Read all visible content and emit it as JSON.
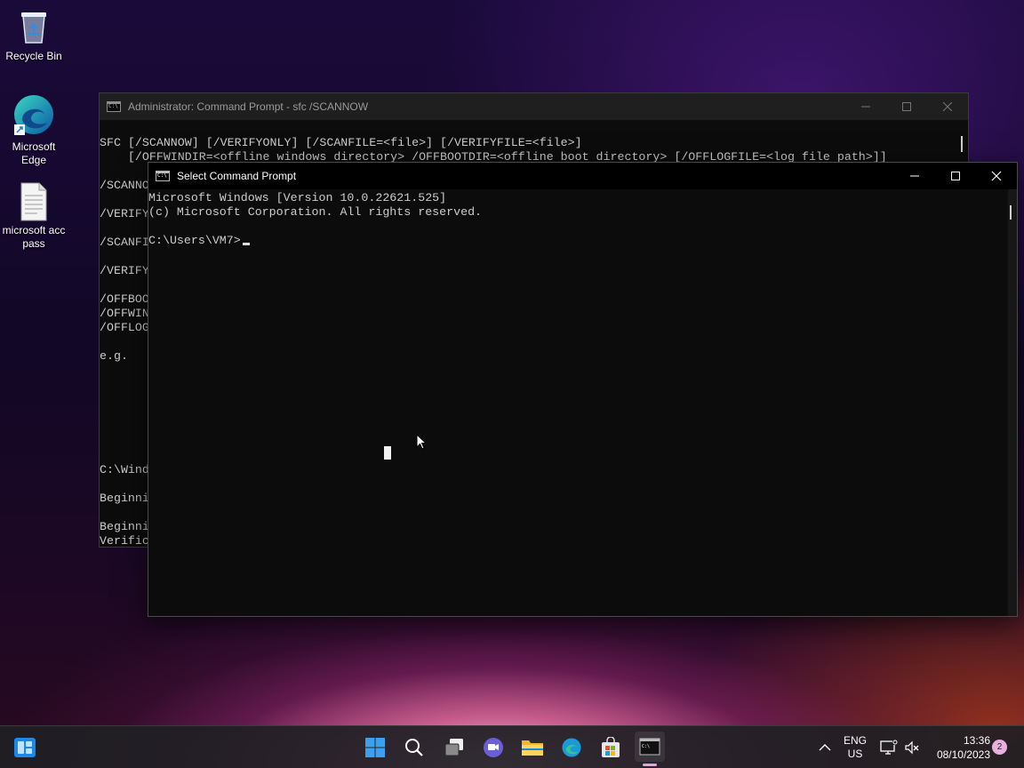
{
  "desktop": {
    "icons": [
      {
        "label": "Recycle Bin"
      },
      {
        "label": "Microsoft Edge"
      },
      {
        "label": "microsoft acc pass"
      }
    ]
  },
  "back_window": {
    "title": "Administrator: Command Prompt - sfc  /SCANNOW",
    "lines": [
      "SFC [/SCANNOW] [/VERIFYONLY] [/SCANFILE=<file>] [/VERIFYFILE=<file>]",
      "    [/OFFWINDIR=<offline windows directory> /OFFBOOTDIR=<offline boot directory> [/OFFLOGFILE=<log file path>]]",
      "",
      "/SCANNO",
      "",
      "/VERIFY",
      "",
      "/SCANFI",
      "",
      "/VERIFY",
      "",
      "/OFFBOO",
      "/OFFWIN",
      "/OFFLOG",
      "",
      "e.g.",
      "",
      "",
      "",
      "",
      "",
      "",
      "",
      "C:\\Wind",
      "",
      "Beginni",
      "",
      "Beginni",
      "Verific"
    ]
  },
  "front_window": {
    "title": "Select Command Prompt",
    "lines": [
      "Microsoft Windows [Version 10.0.22621.525]",
      "(c) Microsoft Corporation. All rights reserved.",
      "",
      "C:\\Users\\VM7>"
    ]
  },
  "tray": {
    "lang_top": "ENG",
    "lang_bottom": "US",
    "time": "13:36",
    "date": "08/10/2023",
    "notification_count": "2"
  },
  "taskbar_icons": [
    "start-icon",
    "search-icon",
    "task-view-icon",
    "chat-icon",
    "file-explorer-icon",
    "edge-icon",
    "store-icon",
    "terminal-icon"
  ],
  "colors": {
    "console_bg": "#0c0c0c",
    "console_fg": "#cccccc",
    "accent": "#0078d4"
  }
}
